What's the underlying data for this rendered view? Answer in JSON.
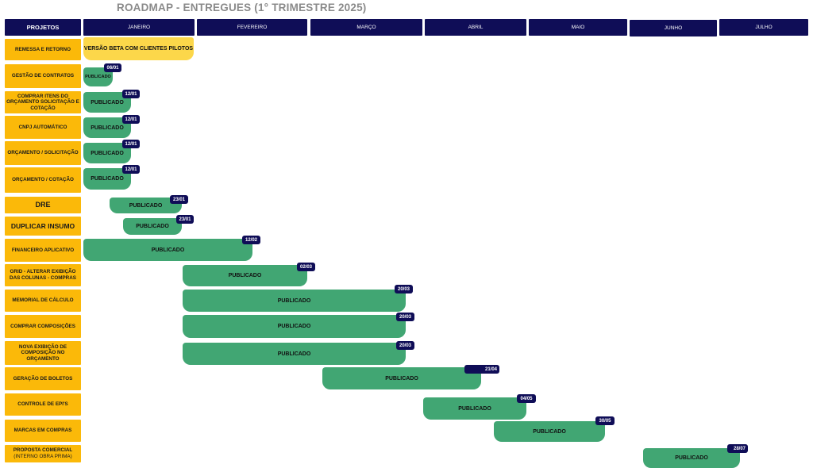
{
  "title": "ROADMAP  - ENTREGUES (1° TRIMESTRE 2025)",
  "colors": {
    "header": "#0f0d57",
    "project": "#fbb909",
    "published": "#41a673",
    "beta": "#fcd74a"
  },
  "header": {
    "projects": "PROJETOS",
    "months": [
      "JANEIRO",
      "FEVEREIRO",
      "MARÇO",
      "ABRIL",
      "MAIO",
      "JUNHO",
      "JULHO"
    ]
  },
  "rows": [
    {
      "project": "REMESSA E RETORNO",
      "bar": "VERSÃO BETA COM CLIENTES PILOTOS",
      "tag": ""
    },
    {
      "project": "GESTÃO DE CONTRATOS",
      "bar": "PUBLICADO",
      "tag": "06/01"
    },
    {
      "project": "COMPRAR ITENS DO ORÇAMENTO SOLICITAÇÃO E COTAÇÃO",
      "bar": "PUBLICADO",
      "tag": "12/01"
    },
    {
      "project": "CNPJ AUTOMÁTICO",
      "bar": "PUBLICADO",
      "tag": "12/01"
    },
    {
      "project": "ORÇAMENTO / SOLICITAÇÃO",
      "bar": "PUBLICADO",
      "tag": "12/01"
    },
    {
      "project": "ORÇAMENTO / COTAÇÃO",
      "bar": "PUBLICADO",
      "tag": "12/01"
    },
    {
      "project": "DRE",
      "bar": "PUBLICADO",
      "tag": "23/01"
    },
    {
      "project": "DUPLICAR INSUMO",
      "bar": "PUBLICADO",
      "tag": "23/01"
    },
    {
      "project": "FINANCEIRO APLICATIVO",
      "bar": "PUBLICADO",
      "tag": "12/02"
    },
    {
      "project": "GRID - ALTERAR EXIBIÇÃO DAS COLUNAS - COMPRAS",
      "bar": "PUBLICADO",
      "tag": "02/03"
    },
    {
      "project": "MEMORIAL DE CÁLCULO",
      "bar": "PUBLICADO",
      "tag": "20/03"
    },
    {
      "project": "COMPRAR COMPOSIÇÕES",
      "bar": "PUBLICADO",
      "tag": "20/03"
    },
    {
      "project": "NOVA EXIBIÇÃO DE COMPOSIÇÃO NO ORÇAMENTO",
      "bar": "PUBLICADO",
      "tag": "20/03"
    },
    {
      "project": "GERAÇÃO DE BOLETOS",
      "bar": "PUBLICADO",
      "tag": "21/04"
    },
    {
      "project": "CONTROLE DE EPI'S",
      "bar": "PUBLICADO",
      "tag": "04/05"
    },
    {
      "project": "MARCAS EM COMPRAS",
      "bar": "PUBLICADO",
      "tag": "30/05"
    },
    {
      "project": "PROPOSTA COMERCIAL",
      "project_sub": "(INTERNO OBRA PRIMA)",
      "bar": "PUBLICADO",
      "tag": "28/07"
    }
  ]
}
